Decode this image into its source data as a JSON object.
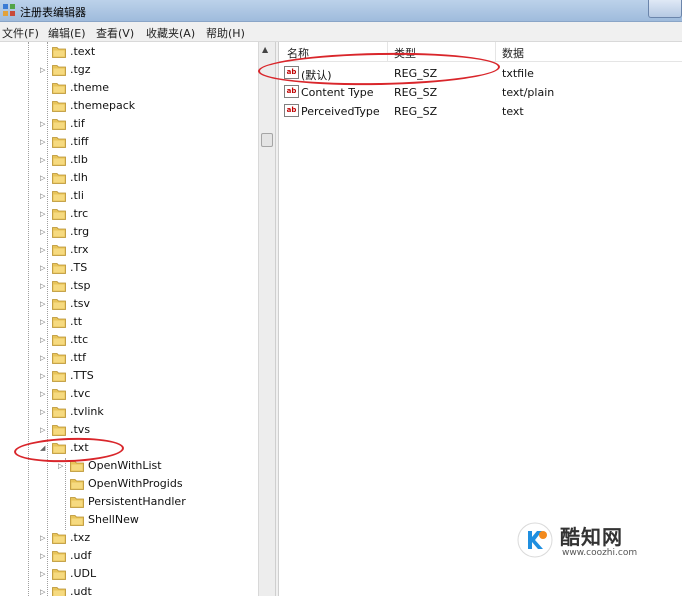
{
  "window": {
    "title": "注册表编辑器",
    "app_icon": "regedit-icon"
  },
  "menubar": {
    "items": [
      {
        "label": "文件(F)"
      },
      {
        "label": "编辑(E)"
      },
      {
        "label": "查看(V)"
      },
      {
        "label": "收藏夹(A)"
      },
      {
        "label": "帮助(H)"
      }
    ]
  },
  "tree": {
    "items": [
      {
        "label": ".text",
        "expander": ""
      },
      {
        "label": ".tgz",
        "expander": "▷"
      },
      {
        "label": ".theme",
        "expander": ""
      },
      {
        "label": ".themepack",
        "expander": ""
      },
      {
        "label": ".tif",
        "expander": "▷"
      },
      {
        "label": ".tiff",
        "expander": "▷"
      },
      {
        "label": ".tlb",
        "expander": "▷"
      },
      {
        "label": ".tlh",
        "expander": "▷"
      },
      {
        "label": ".tli",
        "expander": "▷"
      },
      {
        "label": ".trc",
        "expander": "▷"
      },
      {
        "label": ".trg",
        "expander": "▷"
      },
      {
        "label": ".trx",
        "expander": "▷"
      },
      {
        "label": ".TS",
        "expander": "▷"
      },
      {
        "label": ".tsp",
        "expander": "▷"
      },
      {
        "label": ".tsv",
        "expander": "▷"
      },
      {
        "label": ".tt",
        "expander": "▷"
      },
      {
        "label": ".ttc",
        "expander": "▷"
      },
      {
        "label": ".ttf",
        "expander": "▷"
      },
      {
        "label": ".TTS",
        "expander": "▷"
      },
      {
        "label": ".tvc",
        "expander": "▷"
      },
      {
        "label": ".tvlink",
        "expander": "▷"
      },
      {
        "label": ".tvs",
        "expander": "▷"
      },
      {
        "label": ".txt",
        "expander": "◢"
      }
    ],
    "children": [
      {
        "label": "OpenWithList",
        "expander": "▷"
      },
      {
        "label": "OpenWithProgids",
        "expander": ""
      },
      {
        "label": "PersistentHandler",
        "expander": ""
      },
      {
        "label": "ShellNew",
        "expander": ""
      }
    ],
    "after": [
      {
        "label": ".txz",
        "expander": "▷"
      },
      {
        "label": ".udf",
        "expander": "▷"
      },
      {
        "label": ".UDL",
        "expander": "▷"
      },
      {
        "label": ".udt",
        "expander": "▷"
      }
    ]
  },
  "list": {
    "columns": {
      "name": "名称",
      "type": "类型",
      "data": "数据"
    },
    "rows": [
      {
        "name": "(默认)",
        "type": "REG_SZ",
        "data": "txtfile",
        "icon": "ab"
      },
      {
        "name": "Content Type",
        "type": "REG_SZ",
        "data": "text/plain",
        "icon": "ab"
      },
      {
        "name": "PerceivedType",
        "type": "REG_SZ",
        "data": "text",
        "icon": "ab"
      }
    ]
  },
  "watermark": {
    "name": "酷知网",
    "url": "www.coozhi.com"
  },
  "colors": {
    "annotation": "#d9262b",
    "folder": "#e8c45a"
  }
}
